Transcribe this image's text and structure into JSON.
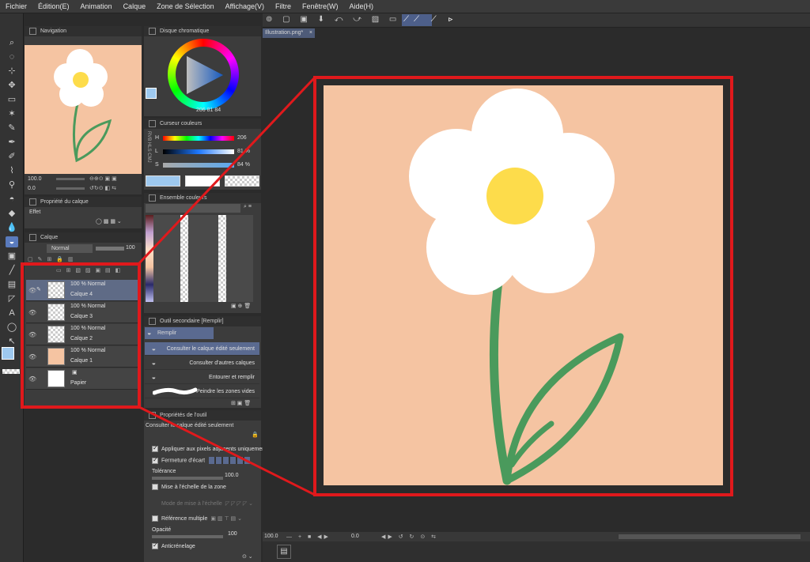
{
  "menu": [
    "Fichier",
    "Édition(E)",
    "Animation",
    "Calque",
    "Zone de Sélection",
    "Affichage(V)",
    "Filtre",
    "Fenêtre(W)",
    "Aide(H)"
  ],
  "document_tab": "Illustration.png*",
  "navigation": {
    "title": "Navigation",
    "zoom": "100.0",
    "angle": "0.0"
  },
  "layer_props": {
    "title": "Propriété du calque",
    "effect_label": "Effet"
  },
  "layer_panel": {
    "title": "Calque",
    "blend_mode": "Normal",
    "opacity": "100",
    "layers": [
      {
        "mode": "100 % Normal",
        "name": "Calque 4"
      },
      {
        "mode": "100 % Normal",
        "name": "Calque 3"
      },
      {
        "mode": "100 % Normal",
        "name": "Calque 2"
      },
      {
        "mode": "100 % Normal",
        "name": "Calque 1"
      },
      {
        "mode": "",
        "name": "Papier"
      }
    ]
  },
  "color_wheel": {
    "title": "Disque chromatique",
    "values": [
      "206",
      "81",
      "84"
    ]
  },
  "color_slider": {
    "title": "Curseur couleurs",
    "tabs": [
      "RVB",
      "HLS",
      "CMJ"
    ],
    "h_label": "H",
    "h_value": "206",
    "l_label": "L",
    "l_value": "81 %",
    "s_label": "S",
    "s_value": "84 %"
  },
  "color_set": {
    "title": "Ensemble couleurs"
  },
  "subtool": {
    "title": "Outil secondaire [Remplir]",
    "group": "Remplir",
    "items": [
      "Consulter le calque édité seulement",
      "Consulter d'autres calques",
      "Entourer et remplir",
      "Peindre les zones vides"
    ]
  },
  "tool_props": {
    "title": "Propriétés de l'outil",
    "header": "Consulter le calque édité seulement",
    "apply_adjacent": "Appliquer aux pixels adjacents uniquement",
    "gap_close": "Fermeture d'écart",
    "tolerance_label": "Tolérance",
    "tolerance_value": "100.0",
    "scale_area": "Mise à l'échelle de la zone",
    "scale_mode": "Mode de mise à l'échelle",
    "multi_ref": "Référence multiple",
    "opacity_label": "Opacité",
    "opacity_value": "100",
    "antialias": "Anticrénelage"
  },
  "statusbar": {
    "zoom": "100.0",
    "angle": "0.0"
  },
  "colors": {
    "canvas_bg": "#f5c4a2",
    "petal": "#ffffff",
    "center": "#fddc4b",
    "stem": "#4a9a5c",
    "highlight": "#e0191c",
    "main_color": "#9ec9ef"
  }
}
